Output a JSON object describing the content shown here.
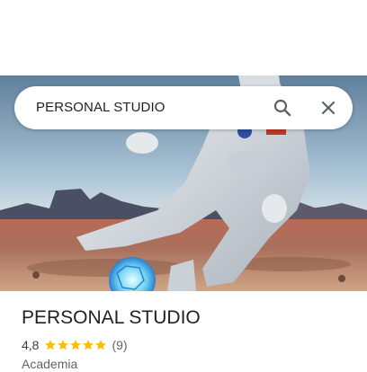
{
  "search": {
    "query": "PERSONAL STUDIO",
    "search_icon": "search-icon",
    "close_icon": "close-icon"
  },
  "place": {
    "name": "PERSONAL STUDIO",
    "rating": "4,8",
    "rating_stars": 5,
    "reviews": "(9)",
    "category": "Academia",
    "star_color": "#fbbc04"
  },
  "colors": {
    "text_primary": "#202124",
    "text_secondary": "#5f6368",
    "icon": "#5f6368"
  }
}
